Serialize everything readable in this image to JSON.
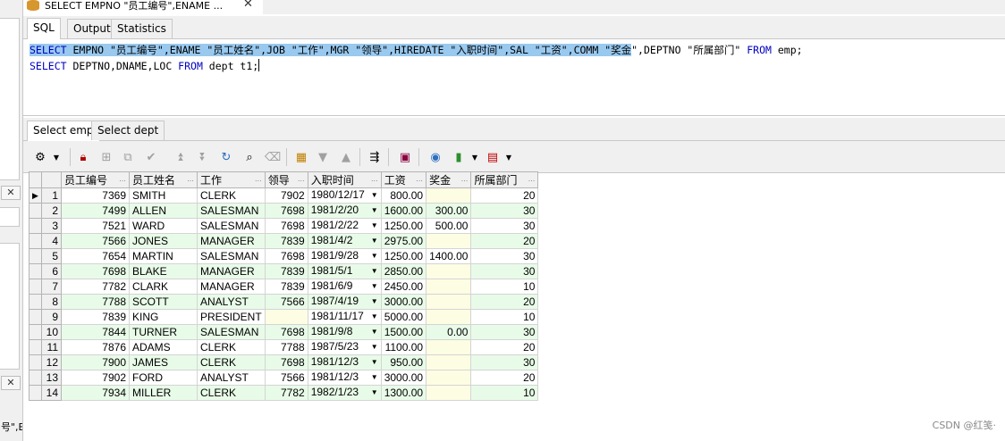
{
  "window": {
    "tab_title": "SELECT EMPNO \"员工编号\",ENAME ...",
    "close": "✕"
  },
  "editor_tabs": [
    "SQL",
    "Output",
    "Statistics"
  ],
  "sql": {
    "line1": [
      {
        "t": "SELECT",
        "kw": true,
        "sel": true
      },
      {
        "t": " EMPNO \"员工编号\",ENAME \"员工姓名\",JOB \"工作\",MGR \"领导\",",
        "kw": false,
        "sel": true
      },
      {
        "t": "HIREDATE",
        "kw": false,
        "sel": true
      },
      {
        "t": " \"入职时间\",SAL \"工资\",COMM \"奖金",
        "kw": false,
        "sel": true
      },
      {
        "t": "\",DEPTNO \"所属部门\" ",
        "kw": false,
        "sel": false
      },
      {
        "t": "FROM",
        "kw": true,
        "sel": false
      },
      {
        "t": " emp;",
        "kw": false,
        "sel": false
      }
    ],
    "line2": [
      {
        "t": "SELECT",
        "kw": true,
        "sel": false
      },
      {
        "t": " DEPTNO,DNAME,LOC ",
        "kw": false,
        "sel": false
      },
      {
        "t": "FROM",
        "kw": true,
        "sel": false
      },
      {
        "t": " dept t1;",
        "kw": false,
        "sel": false
      }
    ]
  },
  "result_tabs": [
    "Select emp",
    "Select dept"
  ],
  "grid": {
    "columns": [
      "员工编号",
      "员工姓名",
      "工作",
      "领导",
      "入职时间",
      "工资",
      "奖金",
      "所属部门"
    ],
    "rows": [
      [
        "1",
        "7369",
        "SMITH",
        "CLERK",
        "7902",
        "1980/12/17",
        "800.00",
        "",
        "20"
      ],
      [
        "2",
        "7499",
        "ALLEN",
        "SALESMAN",
        "7698",
        "1981/2/20",
        "1600.00",
        "300.00",
        "30"
      ],
      [
        "3",
        "7521",
        "WARD",
        "SALESMAN",
        "7698",
        "1981/2/22",
        "1250.00",
        "500.00",
        "30"
      ],
      [
        "4",
        "7566",
        "JONES",
        "MANAGER",
        "7839",
        "1981/4/2",
        "2975.00",
        "",
        "20"
      ],
      [
        "5",
        "7654",
        "MARTIN",
        "SALESMAN",
        "7698",
        "1981/9/28",
        "1250.00",
        "1400.00",
        "30"
      ],
      [
        "6",
        "7698",
        "BLAKE",
        "MANAGER",
        "7839",
        "1981/5/1",
        "2850.00",
        "",
        "30"
      ],
      [
        "7",
        "7782",
        "CLARK",
        "MANAGER",
        "7839",
        "1981/6/9",
        "2450.00",
        "",
        "10"
      ],
      [
        "8",
        "7788",
        "SCOTT",
        "ANALYST",
        "7566",
        "1987/4/19",
        "3000.00",
        "",
        "20"
      ],
      [
        "9",
        "7839",
        "KING",
        "PRESIDENT",
        "",
        "1981/11/17",
        "5000.00",
        "",
        "10"
      ],
      [
        "10",
        "7844",
        "TURNER",
        "SALESMAN",
        "7698",
        "1981/9/8",
        "1500.00",
        "0.00",
        "30"
      ],
      [
        "11",
        "7876",
        "ADAMS",
        "CLERK",
        "7788",
        "1987/5/23",
        "1100.00",
        "",
        "20"
      ],
      [
        "12",
        "7900",
        "JAMES",
        "CLERK",
        "7698",
        "1981/12/3",
        "950.00",
        "",
        "30"
      ],
      [
        "13",
        "7902",
        "FORD",
        "ANALYST",
        "7566",
        "1981/12/3",
        "3000.00",
        "",
        "20"
      ],
      [
        "14",
        "7934",
        "MILLER",
        "CLERK",
        "7782",
        "1982/1/23",
        "1300.00",
        "",
        "10"
      ]
    ]
  },
  "left_panel": {
    "close1": "✕",
    "close2": "✕",
    "fragment": "号\",EN"
  },
  "watermark": "CSDN @红笺·",
  "colors": {
    "selection": "#99c9ef",
    "keyword": "#0000c0",
    "row_alt": "#e8fbe8"
  }
}
